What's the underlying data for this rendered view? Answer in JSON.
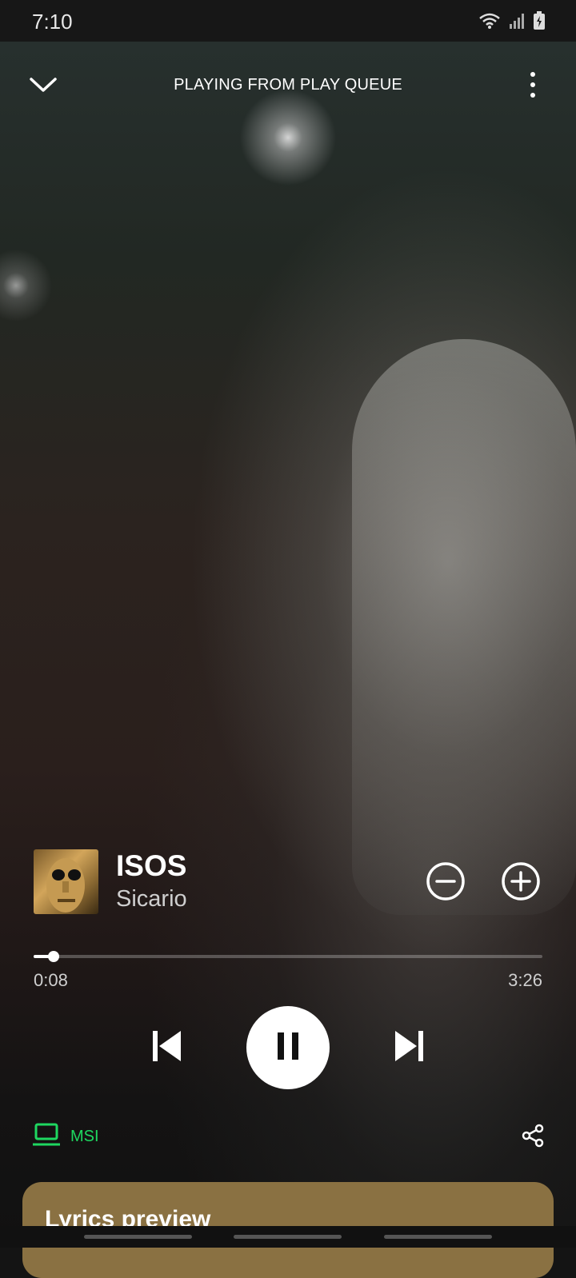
{
  "status_bar": {
    "time": "7:10",
    "icons": [
      "wifi-icon",
      "signal-icon",
      "battery-charging-icon"
    ]
  },
  "header": {
    "title": "PLAYING FROM PLAY QUEUE",
    "collapse_icon": "chevron-down-icon",
    "menu_icon": "more-vertical-icon"
  },
  "track": {
    "title": "ISOS",
    "artist": "Sicario",
    "remove_icon": "minus-circle-icon",
    "add_icon": "plus-circle-icon"
  },
  "playback": {
    "elapsed": "0:08",
    "duration": "3:26",
    "progress_fraction": 0.04,
    "state": "playing"
  },
  "controls": {
    "previous_icon": "skip-previous-icon",
    "pause_icon": "pause-icon",
    "next_icon": "skip-next-icon"
  },
  "footer": {
    "device_label": "MSI",
    "device_icon": "laptop-icon",
    "share_icon": "share-icon",
    "accent_color": "#1ed760"
  },
  "lyrics": {
    "title": "Lyrics preview",
    "card_color": "#8a7142"
  }
}
